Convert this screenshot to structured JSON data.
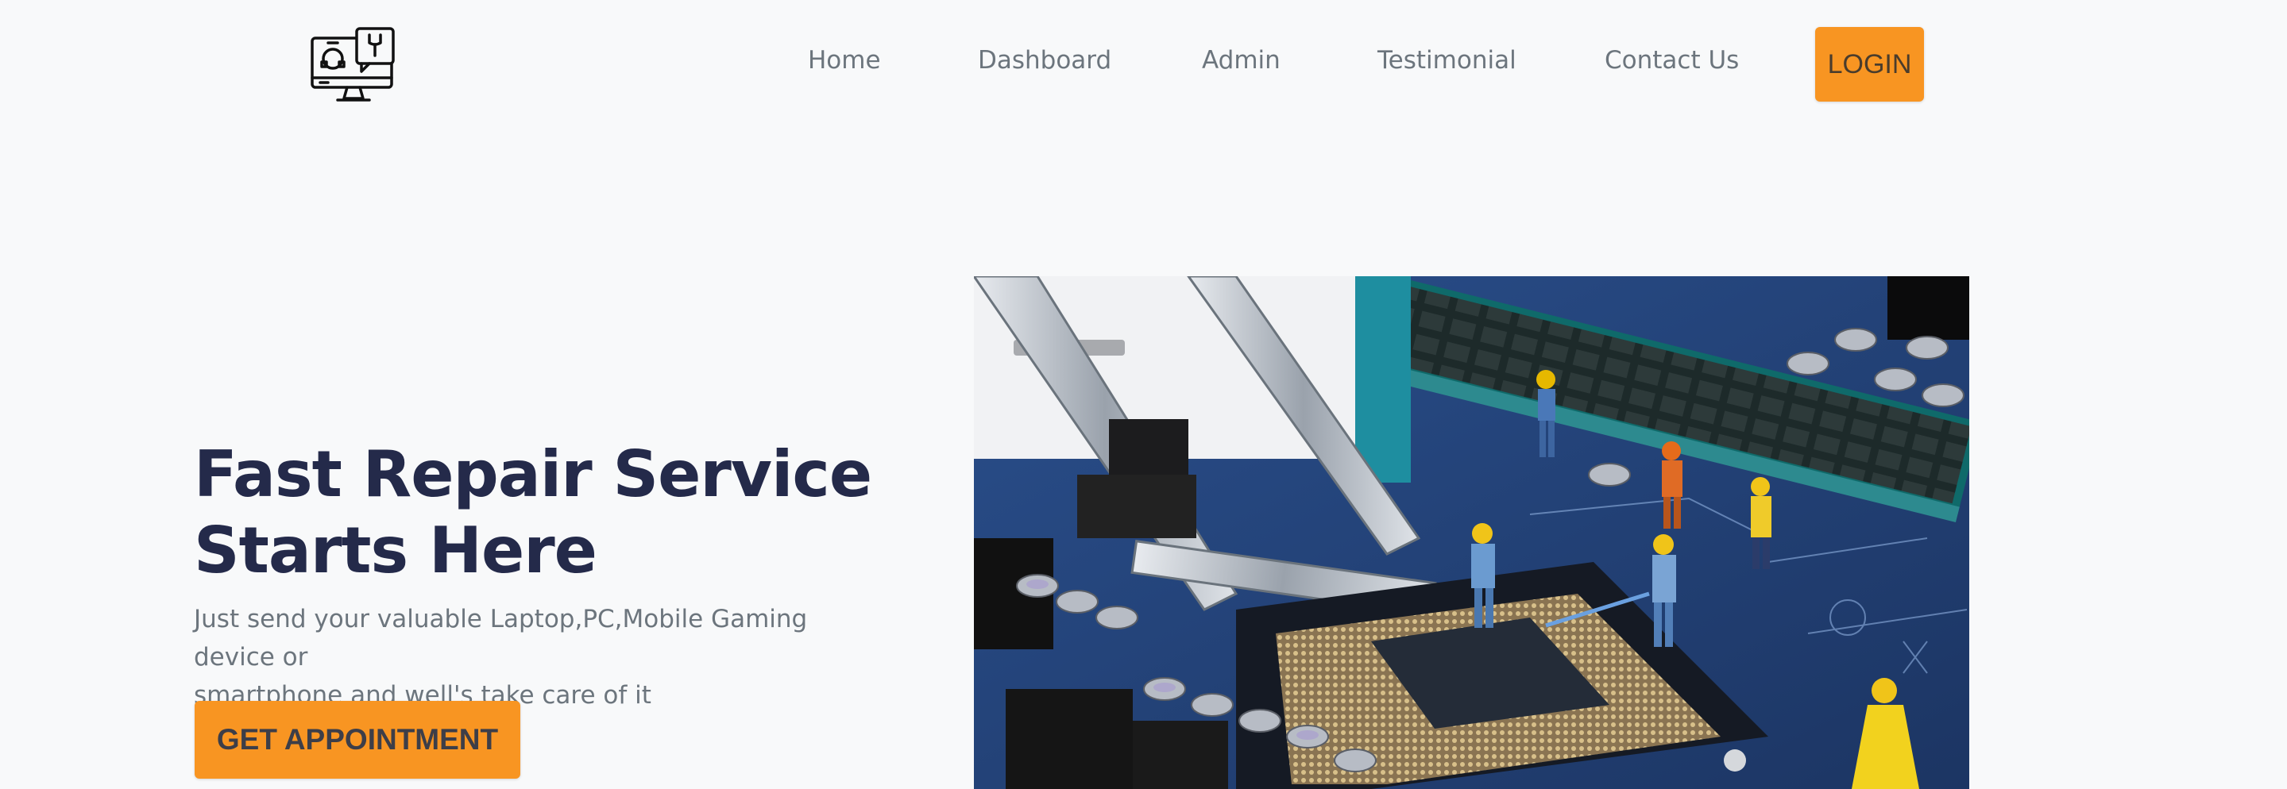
{
  "nav": {
    "logo_icon": "computer-repair-icon",
    "items": [
      {
        "label": "Home"
      },
      {
        "label": "Dashboard"
      },
      {
        "label": "Admin"
      },
      {
        "label": "Testimonial"
      },
      {
        "label": "Contact Us"
      }
    ],
    "login_label": "LOGIN"
  },
  "hero": {
    "title_line1": "Fast Repair Service",
    "title_line2": "Starts Here",
    "subtitle_line1": "Just send your valuable Laptop,PC,Mobile Gaming device or",
    "subtitle_line2": "smartphone and well's take care of it",
    "cta_label": "GET APPOINTMENT",
    "image_icon": "motherboard-repair-image"
  },
  "colors": {
    "accent": "#f89522",
    "background": "#f8f9fa",
    "title": "#242a4a",
    "text_muted": "#6c757d"
  }
}
